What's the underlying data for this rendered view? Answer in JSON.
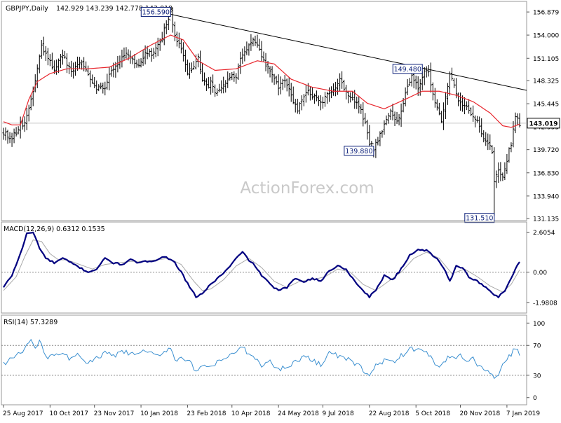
{
  "header": {
    "symbol_label": "GBPJPY,Daily",
    "ohlc_label": "142.929 143.239 142.778 143.019"
  },
  "watermark": "ActionForex.com",
  "colors": {
    "bars": "#000000",
    "ma": "#e8262d",
    "trendline": "#000000",
    "macd_main": "#000080",
    "macd_signal": "#aaaaaa",
    "rsi": "#3a8fd0",
    "grid": "#c8c8c8",
    "label_box": "#0a1e78"
  },
  "chart_data": [
    {
      "type": "ohlc",
      "name": "price",
      "title": "GBPJPY,Daily",
      "ylim": [
        131.135,
        157.5
      ],
      "yticks": [
        156.879,
        154.0,
        151.105,
        148.325,
        145.445,
        142.555,
        139.72,
        136.83,
        133.94,
        131.135
      ],
      "ytick_labels": [
        "156.879",
        "154.000",
        "151.105",
        "148.325",
        "145.445",
        "142.555",
        "139.720",
        "136.830",
        "133.940",
        "131.135"
      ],
      "xlabels": [
        "25 Aug 2017",
        "10 Oct 2017",
        "23 Nov 2017",
        "10 Jan 2018",
        "23 Feb 2018",
        "10 Apr 2018",
        "24 May 2018",
        "9 Jul 2018",
        "22 Aug 2018",
        "5 Oct 2018",
        "20 Nov 2018",
        "7 Jan 2019"
      ],
      "n_bars": 245,
      "anchors": [
        [
          0,
          142.0
        ],
        [
          3,
          140.8
        ],
        [
          6,
          141.8
        ],
        [
          8,
          143.2
        ],
        [
          10,
          142.8
        ],
        [
          14,
          147.0
        ],
        [
          18,
          152.5
        ],
        [
          21,
          151.0
        ],
        [
          24,
          149.8
        ],
        [
          28,
          151.5
        ],
        [
          32,
          149.2
        ],
        [
          36,
          150.8
        ],
        [
          40,
          149.2
        ],
        [
          44,
          147.5
        ],
        [
          48,
          147.5
        ],
        [
          50,
          149.3
        ],
        [
          54,
          150.6
        ],
        [
          58,
          151.5
        ],
        [
          62,
          150.5
        ],
        [
          64,
          150.0
        ],
        [
          67,
          152.0
        ],
        [
          70,
          151.5
        ],
        [
          72,
          152.5
        ],
        [
          75,
          153.8
        ],
        [
          77,
          155.5
        ],
        [
          79,
          156.59
        ],
        [
          81,
          154.0
        ],
        [
          84,
          152.0
        ],
        [
          87,
          149.5
        ],
        [
          90,
          150.0
        ],
        [
          92,
          151.0
        ],
        [
          94,
          148.6
        ],
        [
          96,
          147.5
        ],
        [
          98,
          148.2
        ],
        [
          100,
          146.7
        ],
        [
          103,
          147.2
        ],
        [
          105,
          148.0
        ],
        [
          108,
          149.0
        ],
        [
          110,
          148.5
        ],
        [
          112,
          151.0
        ],
        [
          115,
          152.5
        ],
        [
          118,
          153.3
        ],
        [
          121,
          152.0
        ],
        [
          124,
          150.3
        ],
        [
          127,
          149.2
        ],
        [
          130,
          147.5
        ],
        [
          132,
          148.2
        ],
        [
          134,
          147.8
        ],
        [
          137,
          145.6
        ],
        [
          139,
          144.6
        ],
        [
          141,
          145.8
        ],
        [
          144,
          147.0
        ],
        [
          147,
          146.3
        ],
        [
          150,
          145.4
        ],
        [
          153,
          146.4
        ],
        [
          156,
          147.2
        ],
        [
          159,
          148.7
        ],
        [
          162,
          146.8
        ],
        [
          165,
          146.1
        ],
        [
          168,
          145.1
        ],
        [
          171,
          143.0
        ],
        [
          173,
          140.6
        ],
        [
          175,
          139.88
        ],
        [
          177,
          141.0
        ],
        [
          180,
          143.0
        ],
        [
          183,
          144.3
        ],
        [
          186,
          143.1
        ],
        [
          188,
          144.6
        ],
        [
          190,
          147.0
        ],
        [
          193,
          148.9
        ],
        [
          196,
          147.6
        ],
        [
          199,
          149.2
        ],
        [
          201,
          149.3
        ],
        [
          203,
          146.6
        ],
        [
          205,
          145.2
        ],
        [
          207,
          143.4
        ],
        [
          209,
          146.4
        ],
        [
          211,
          148.8
        ],
        [
          213,
          147.8
        ],
        [
          215,
          146.0
        ],
        [
          217,
          145.4
        ],
        [
          219,
          145.3
        ],
        [
          221,
          144.0
        ],
        [
          223,
          143.6
        ],
        [
          225,
          142.6
        ],
        [
          227,
          141.1
        ],
        [
          229,
          140.3
        ],
        [
          231,
          139.6
        ],
        [
          232,
          135.7
        ],
        [
          234,
          137.3
        ],
        [
          236,
          136.7
        ],
        [
          238,
          138.4
        ],
        [
          240,
          140.6
        ],
        [
          242,
          144.1
        ],
        [
          244,
          143.019
        ]
      ],
      "annotations": [
        {
          "bar": 79,
          "label": "156.590"
        },
        {
          "bar": 175,
          "label": "139.880"
        },
        {
          "bar": 198,
          "label": "149.480"
        },
        {
          "bar": 232,
          "label": "131.510"
        }
      ],
      "last_price": 143.019,
      "last_price_label": "143.019",
      "trendline": [
        [
          79,
          156.59
        ],
        [
          244,
          147.3
        ]
      ],
      "ma_anchors": [
        [
          0,
          143.2
        ],
        [
          4,
          142.8
        ],
        [
          8,
          142.8
        ],
        [
          12,
          146.0
        ],
        [
          16,
          148.2
        ],
        [
          22,
          149.2
        ],
        [
          30,
          149.8
        ],
        [
          40,
          149.8
        ],
        [
          50,
          150.0
        ],
        [
          60,
          151.2
        ],
        [
          70,
          152.8
        ],
        [
          79,
          154.0
        ],
        [
          85,
          153.4
        ],
        [
          92,
          150.8
        ],
        [
          100,
          149.6
        ],
        [
          110,
          149.8
        ],
        [
          120,
          150.8
        ],
        [
          128,
          150.4
        ],
        [
          136,
          148.5
        ],
        [
          146,
          147.5
        ],
        [
          156,
          147.0
        ],
        [
          165,
          147.0
        ],
        [
          172,
          145.5
        ],
        [
          180,
          144.8
        ],
        [
          190,
          146.0
        ],
        [
          198,
          147.0
        ],
        [
          206,
          147.0
        ],
        [
          214,
          146.5
        ],
        [
          222,
          145.7
        ],
        [
          230,
          144.3
        ],
        [
          236,
          142.7
        ],
        [
          240,
          142.5
        ],
        [
          244,
          142.9
        ]
      ]
    },
    {
      "type": "line",
      "name": "macd",
      "title": "MACD(12,26,9) 0.6312 0.1535",
      "ylim": [
        -2.35,
        2.95
      ],
      "yticks": [
        2.6054,
        0.0,
        -1.9808
      ],
      "ytick_labels": [
        "2.6054",
        "0.00",
        "-1.9808"
      ],
      "dotted_level": 0.0,
      "anchors": [
        [
          0,
          -1.0
        ],
        [
          4,
          -0.2
        ],
        [
          8,
          1.2
        ],
        [
          11,
          2.5
        ],
        [
          14,
          2.6
        ],
        [
          17,
          1.6
        ],
        [
          20,
          0.9
        ],
        [
          24,
          0.6
        ],
        [
          28,
          0.9
        ],
        [
          32,
          0.6
        ],
        [
          36,
          0.3
        ],
        [
          40,
          0.0
        ],
        [
          44,
          0.2
        ],
        [
          48,
          0.9
        ],
        [
          52,
          0.6
        ],
        [
          56,
          0.5
        ],
        [
          60,
          0.8
        ],
        [
          64,
          0.6
        ],
        [
          68,
          0.7
        ],
        [
          72,
          0.8
        ],
        [
          76,
          1.0
        ],
        [
          80,
          0.8
        ],
        [
          84,
          0.0
        ],
        [
          88,
          -1.0
        ],
        [
          91,
          -1.6
        ],
        [
          94,
          -1.4
        ],
        [
          98,
          -0.8
        ],
        [
          102,
          -0.3
        ],
        [
          106,
          0.2
        ],
        [
          110,
          0.9
        ],
        [
          113,
          1.3
        ],
        [
          116,
          0.8
        ],
        [
          119,
          0.4
        ],
        [
          122,
          -0.2
        ],
        [
          126,
          -0.8
        ],
        [
          130,
          -1.2
        ],
        [
          134,
          -1.0
        ],
        [
          138,
          -0.4
        ],
        [
          142,
          -0.6
        ],
        [
          146,
          -0.4
        ],
        [
          150,
          -0.6
        ],
        [
          154,
          0.1
        ],
        [
          158,
          0.4
        ],
        [
          162,
          0.2
        ],
        [
          166,
          -0.6
        ],
        [
          170,
          -1.2
        ],
        [
          173,
          -1.6
        ],
        [
          176,
          -1.2
        ],
        [
          180,
          -0.2
        ],
        [
          184,
          -0.5
        ],
        [
          188,
          0.2
        ],
        [
          192,
          1.1
        ],
        [
          196,
          1.5
        ],
        [
          200,
          1.4
        ],
        [
          204,
          1.0
        ],
        [
          208,
          0.3
        ],
        [
          211,
          -0.6
        ],
        [
          214,
          0.4
        ],
        [
          217,
          0.3
        ],
        [
          220,
          -0.3
        ],
        [
          224,
          -0.6
        ],
        [
          228,
          -1.0
        ],
        [
          231,
          -1.4
        ],
        [
          234,
          -1.6
        ],
        [
          237,
          -1.2
        ],
        [
          240,
          -0.4
        ],
        [
          243,
          0.5
        ],
        [
          244,
          0.63
        ]
      ],
      "signal_anchors": [
        [
          0,
          -1.2
        ],
        [
          6,
          -0.3
        ],
        [
          10,
          1.0
        ],
        [
          14,
          2.1
        ],
        [
          18,
          2.0
        ],
        [
          22,
          1.2
        ],
        [
          26,
          0.8
        ],
        [
          30,
          0.8
        ],
        [
          36,
          0.5
        ],
        [
          42,
          0.2
        ],
        [
          48,
          0.5
        ],
        [
          54,
          0.6
        ],
        [
          60,
          0.7
        ],
        [
          66,
          0.7
        ],
        [
          72,
          0.8
        ],
        [
          78,
          0.9
        ],
        [
          84,
          0.5
        ],
        [
          90,
          -0.6
        ],
        [
          94,
          -1.2
        ],
        [
          98,
          -1.1
        ],
        [
          104,
          -0.5
        ],
        [
          110,
          0.4
        ],
        [
          116,
          0.9
        ],
        [
          122,
          0.3
        ],
        [
          128,
          -0.6
        ],
        [
          134,
          -1.0
        ],
        [
          140,
          -0.6
        ],
        [
          146,
          -0.5
        ],
        [
          152,
          -0.3
        ],
        [
          158,
          0.2
        ],
        [
          164,
          0.0
        ],
        [
          170,
          -0.8
        ],
        [
          176,
          -1.2
        ],
        [
          182,
          -0.6
        ],
        [
          188,
          0.0
        ],
        [
          194,
          0.9
        ],
        [
          200,
          1.3
        ],
        [
          206,
          0.9
        ],
        [
          212,
          -0.1
        ],
        [
          218,
          0.2
        ],
        [
          224,
          -0.3
        ],
        [
          230,
          -0.9
        ],
        [
          236,
          -1.3
        ],
        [
          240,
          -0.8
        ],
        [
          244,
          0.15
        ]
      ]
    },
    {
      "type": "line",
      "name": "rsi",
      "title": "RSI(14) 57.3289",
      "ylim": [
        -4,
        105
      ],
      "yticks": [
        100,
        70,
        30,
        0
      ],
      "ytick_labels": [
        "100",
        "70",
        "30",
        "0"
      ],
      "dotted_levels": [
        70,
        30
      ],
      "anchors": [
        [
          0,
          45
        ],
        [
          3,
          52
        ],
        [
          6,
          55
        ],
        [
          9,
          62
        ],
        [
          11,
          70
        ],
        [
          13,
          78
        ],
        [
          15,
          65
        ],
        [
          17,
          75
        ],
        [
          19,
          62
        ],
        [
          21,
          55
        ],
        [
          24,
          60
        ],
        [
          28,
          57
        ],
        [
          32,
          52
        ],
        [
          36,
          58
        ],
        [
          40,
          46
        ],
        [
          44,
          52
        ],
        [
          48,
          60
        ],
        [
          52,
          55
        ],
        [
          56,
          62
        ],
        [
          60,
          58
        ],
        [
          64,
          60
        ],
        [
          68,
          62
        ],
        [
          72,
          55
        ],
        [
          76,
          62
        ],
        [
          79,
          68
        ],
        [
          81,
          50
        ],
        [
          84,
          55
        ],
        [
          88,
          48
        ],
        [
          91,
          34
        ],
        [
          94,
          40
        ],
        [
          98,
          42
        ],
        [
          102,
          48
        ],
        [
          106,
          55
        ],
        [
          110,
          62
        ],
        [
          113,
          67
        ],
        [
          116,
          58
        ],
        [
          119,
          52
        ],
        [
          122,
          44
        ],
        [
          126,
          48
        ],
        [
          130,
          37
        ],
        [
          134,
          43
        ],
        [
          138,
          48
        ],
        [
          142,
          55
        ],
        [
          146,
          50
        ],
        [
          150,
          45
        ],
        [
          154,
          60
        ],
        [
          158,
          56
        ],
        [
          162,
          52
        ],
        [
          166,
          46
        ],
        [
          170,
          38
        ],
        [
          173,
          28
        ],
        [
          176,
          43
        ],
        [
          180,
          50
        ],
        [
          184,
          46
        ],
        [
          188,
          56
        ],
        [
          192,
          64
        ],
        [
          196,
          67
        ],
        [
          200,
          60
        ],
        [
          204,
          46
        ],
        [
          207,
          42
        ],
        [
          210,
          56
        ],
        [
          213,
          52
        ],
        [
          216,
          58
        ],
        [
          219,
          47
        ],
        [
          222,
          52
        ],
        [
          225,
          42
        ],
        [
          228,
          37
        ],
        [
          231,
          33
        ],
        [
          232,
          23
        ],
        [
          235,
          38
        ],
        [
          238,
          50
        ],
        [
          241,
          62
        ],
        [
          243,
          65
        ],
        [
          244,
          57.3
        ]
      ]
    }
  ]
}
